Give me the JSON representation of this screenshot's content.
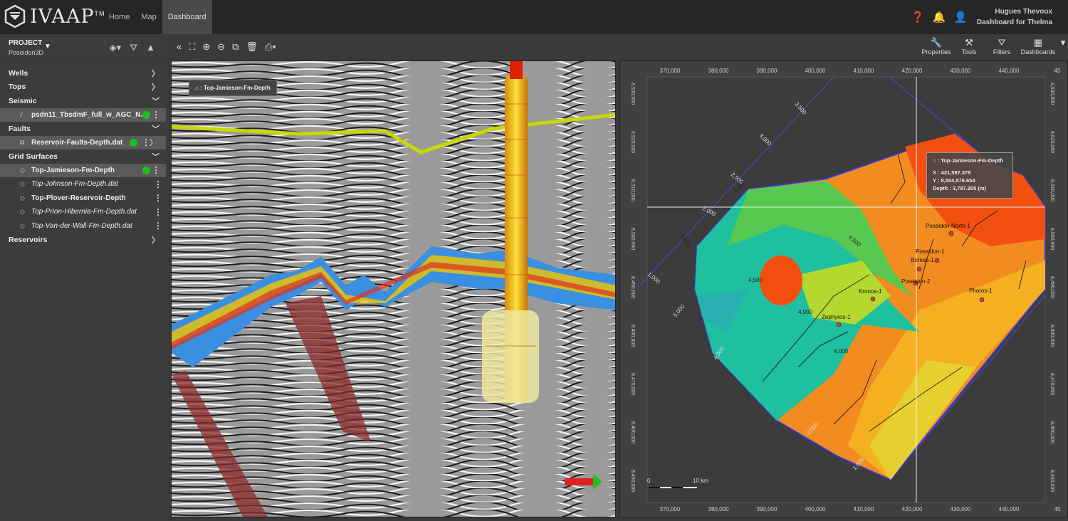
{
  "app": {
    "logo_text": "IVAAP",
    "logo_tm": "TM",
    "nav": [
      "Home",
      "Map",
      "Dashboard"
    ],
    "active_nav": "Dashboard"
  },
  "user": {
    "name": "Hugues Thevoux",
    "dashboard": "Dashboard for Thelma"
  },
  "project": {
    "label": "PROJECT",
    "name": "Poseidon3D"
  },
  "tree": {
    "wells": "Wells",
    "tops": "Tops",
    "seismic": "Seismic",
    "seismic_item": "psdn11_TbsdmF_full_w_AGC_N...",
    "faults": "Faults",
    "faults_item": "Reservoir-Faults-Depth.dat",
    "grid_surfaces": "Grid Surfaces",
    "surfaces": [
      "Top-Jamieson-Fm-Depth",
      "Top-Johnson-Fm-Depth.dat",
      "Top-Plover-Reservoir-Depth",
      "Top-Prion-Hibernia-Fm-Depth.dat",
      "Top-Van-der-Wall-Fm-Depth.dat"
    ],
    "reservoirs": "Reservoirs"
  },
  "toolbar_right": [
    "Properties",
    "Tools",
    "Filters",
    "Dashboards"
  ],
  "view3d": {
    "tag": "Top-Jamieson-Fm-Depth"
  },
  "map": {
    "x_ticks": [
      "370,000",
      "380,000",
      "390,000",
      "400,000",
      "410,000",
      "420,000",
      "430,000",
      "440,000",
      "45"
    ],
    "y_ticks": [
      "8,530,000",
      "8,520,000",
      "8,510,000",
      "8,500,000",
      "8,490,000",
      "8,480,000",
      "8,470,000",
      "8,460,000",
      "8,450,000"
    ],
    "tooltip": {
      "title": "Top-Jamieson-Fm-Depth",
      "x": "X : 421,597.379",
      "y": "Y : 8,504,576.654",
      "depth": "Depth : 3,787.205 (m)"
    },
    "wells": [
      "Poseidon-North-1",
      "Poseidon-1",
      "Boreas-1",
      "Poseidon-2",
      "Kronos-1",
      "Pharos-1",
      "Zephyros-1"
    ],
    "contours": [
      "3,500",
      "3,000",
      "2,500",
      "2,000",
      "1,000",
      "5,000",
      "4,000",
      "2,000",
      "1,000",
      "1570",
      "4,000",
      "4,500",
      "4,000",
      "4,500",
      "4,000"
    ],
    "scale": {
      "zero": "0",
      "end": "10 km"
    }
  },
  "colors": {
    "accent_green": "#1ec020",
    "topbar": "#262626"
  }
}
